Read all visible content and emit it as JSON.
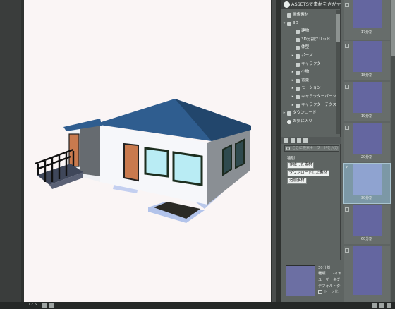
{
  "assets_panel": {
    "title": "ASSETSで素材をさがす",
    "tree": [
      {
        "label": "画像素材",
        "arrow": "",
        "level": 0
      },
      {
        "label": "3D",
        "arrow": "▾",
        "level": 0
      },
      {
        "label": "建物",
        "arrow": "",
        "level": 1
      },
      {
        "label": "3D分割グリッド",
        "arrow": "",
        "level": 1
      },
      {
        "label": "体型",
        "arrow": "",
        "level": 1
      },
      {
        "label": "ポーズ",
        "arrow": "▸",
        "level": 1
      },
      {
        "label": "キャラクター",
        "arrow": "",
        "level": 1
      },
      {
        "label": "小物",
        "arrow": "▸",
        "level": 1
      },
      {
        "label": "背景",
        "arrow": "▸",
        "level": 1
      },
      {
        "label": "モーション",
        "arrow": "▸",
        "level": 1
      },
      {
        "label": "キャラクターパーツ",
        "arrow": "▸",
        "level": 1
      },
      {
        "label": "キャラクターテクスチャ",
        "arrow": "▸",
        "level": 1
      },
      {
        "label": "ダウンロード",
        "arrow": "▸",
        "level": 0
      },
      {
        "label": "お気に入り",
        "arrow": "",
        "level": 0
      }
    ],
    "search_placeholder": "ここに検索キーワードを入力",
    "filter_heading": "種別",
    "filter_buttons": [
      "作成した素材",
      "ダウンロードした素材",
      "追加素材"
    ]
  },
  "info": {
    "name": "30分割",
    "type_label": "種類",
    "type_value": "レイヤー",
    "user_tag": "ユーザータグ",
    "default_tag": "デフォルトタグ",
    "checkbox_label": "トーン化"
  },
  "thumbnails": [
    {
      "label": "17分割",
      "selected": false
    },
    {
      "label": "18分割",
      "selected": false
    },
    {
      "label": "19分割",
      "selected": false
    },
    {
      "label": "20分割",
      "selected": false
    },
    {
      "label": "30分割",
      "selected": true
    },
    {
      "label": "60分割",
      "selected": false
    }
  ],
  "status_bar": {
    "zoom": "12.5"
  },
  "colors": {
    "roof": "#2f5d8f",
    "walls": "#f4f5f8",
    "door": "#c97a4e",
    "window": "#b9ecf4"
  }
}
